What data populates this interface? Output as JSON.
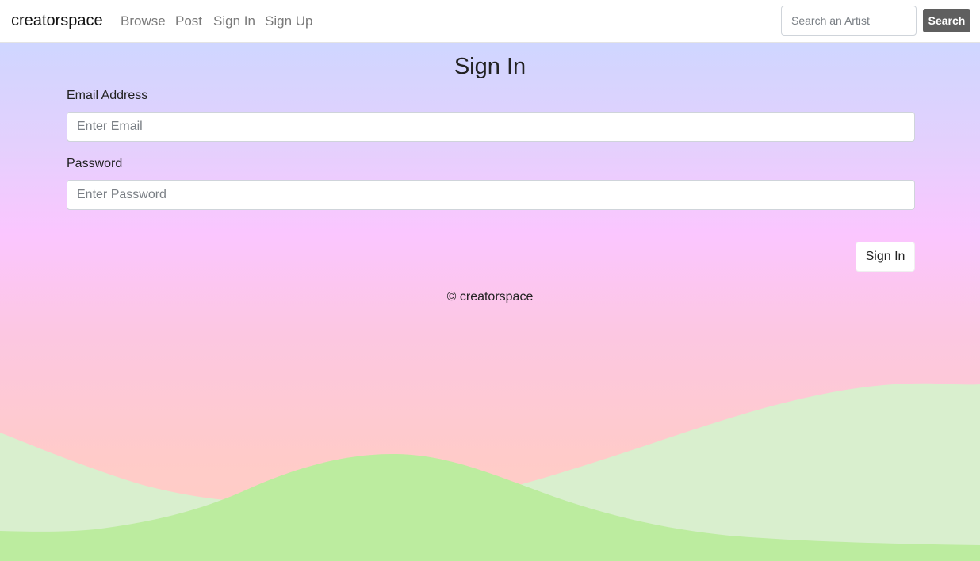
{
  "navbar": {
    "brand": "creatorspace",
    "links": [
      "Browse",
      "Post",
      "Sign In",
      "Sign Up"
    ],
    "search_placeholder": "Search an Artist",
    "search_button": "Search"
  },
  "form": {
    "title": "Sign In",
    "email_label": "Email Address",
    "email_placeholder": "Enter Email",
    "password_label": "Password",
    "password_placeholder": "Enter Password",
    "submit_label": "Sign In"
  },
  "footer": {
    "text": "© creatorspace"
  },
  "colors": {
    "gradient_top": "#cfd6ff",
    "gradient_mid": "#fbc6ff",
    "gradient_bottom": "#ffcfc3",
    "hill_light": "#d9efce",
    "hill_dark": "#bcec9f",
    "search_button": "#5f5f5f"
  }
}
